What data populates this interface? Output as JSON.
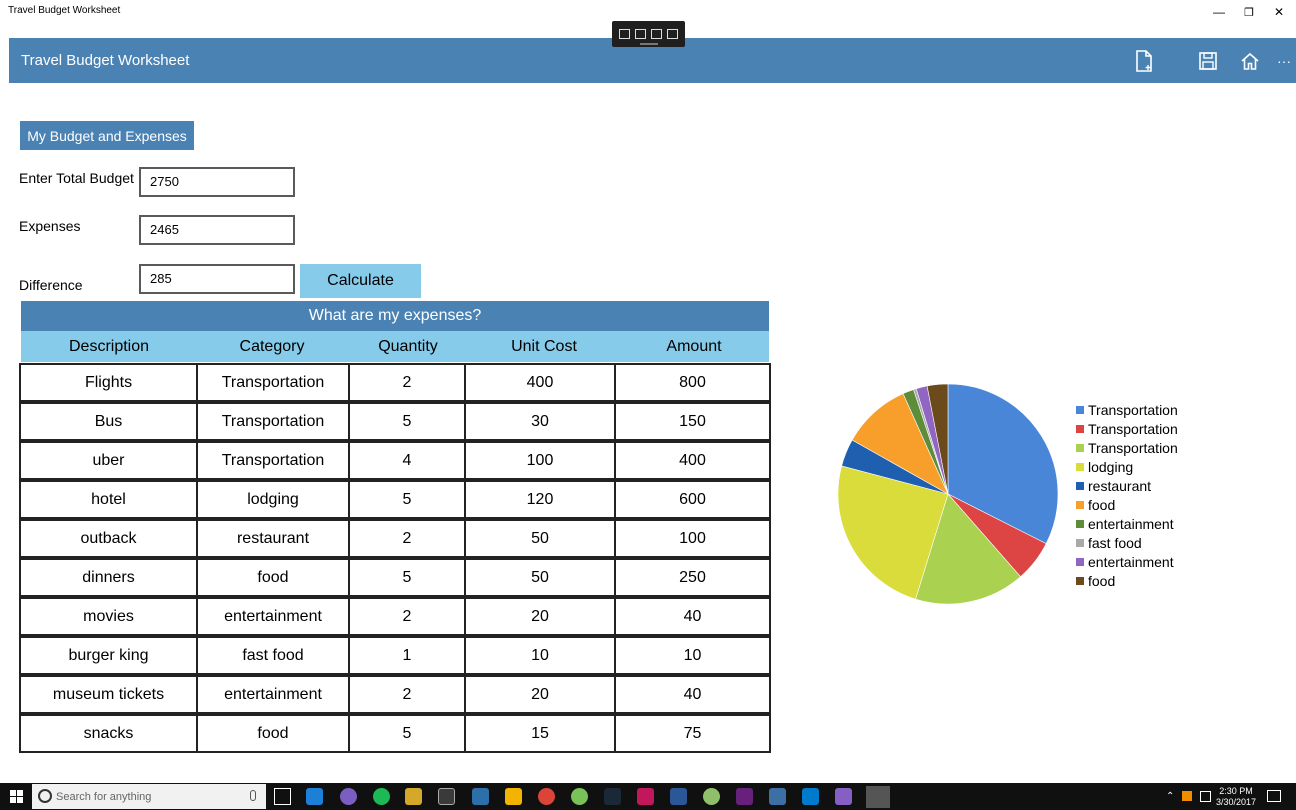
{
  "window": {
    "title": "Travel Budget Worksheet"
  },
  "appbar": {
    "title": "Travel Budget Worksheet",
    "more": "···"
  },
  "section": {
    "label": "My Budget and Expenses"
  },
  "form": {
    "budget_label": "Enter Total Budget",
    "budget_value": "2750",
    "expenses_label": "Expenses",
    "expenses_value": "2465",
    "difference_label": "Difference",
    "difference_value": "285",
    "calculate_label": "Calculate"
  },
  "table": {
    "title": "What are my expenses?",
    "columns": [
      "Description",
      "Category",
      "Quantity",
      "Unit Cost",
      "Amount"
    ],
    "rows": [
      [
        "Flights",
        "Transportation",
        "2",
        "400",
        "800"
      ],
      [
        "Bus",
        "Transportation",
        "5",
        "30",
        "150"
      ],
      [
        "uber",
        "Transportation",
        "4",
        "100",
        "400"
      ],
      [
        "hotel",
        "lodging",
        "5",
        "120",
        "600"
      ],
      [
        "outback",
        "restaurant",
        "2",
        "50",
        "100"
      ],
      [
        "dinners",
        "food",
        "5",
        "50",
        "250"
      ],
      [
        "movies",
        "entertainment",
        "2",
        "20",
        "40"
      ],
      [
        "burger king",
        "fast food",
        "1",
        "10",
        "10"
      ],
      [
        "museum tickets",
        "entertainment",
        "2",
        "20",
        "40"
      ],
      [
        "snacks",
        "food",
        "5",
        "15",
        "75"
      ]
    ]
  },
  "chart_data": {
    "type": "pie",
    "categories": [
      "Transportation",
      "Transportation",
      "Transportation",
      "lodging",
      "restaurant",
      "food",
      "entertainment",
      "fast food",
      "entertainment",
      "food"
    ],
    "values": [
      800,
      150,
      400,
      600,
      100,
      250,
      40,
      10,
      40,
      75
    ],
    "colors": [
      "#4a86d8",
      "#dd4444",
      "#aad14f",
      "#d9dc3a",
      "#1f5fb0",
      "#f79f2a",
      "#5e8d3a",
      "#a9a9a9",
      "#9066c2",
      "#6b4a1c"
    ],
    "legend": "right",
    "title": ""
  },
  "taskbar": {
    "search_placeholder": "Search for anything",
    "time": "2:30 PM",
    "date": "3/30/2017"
  }
}
